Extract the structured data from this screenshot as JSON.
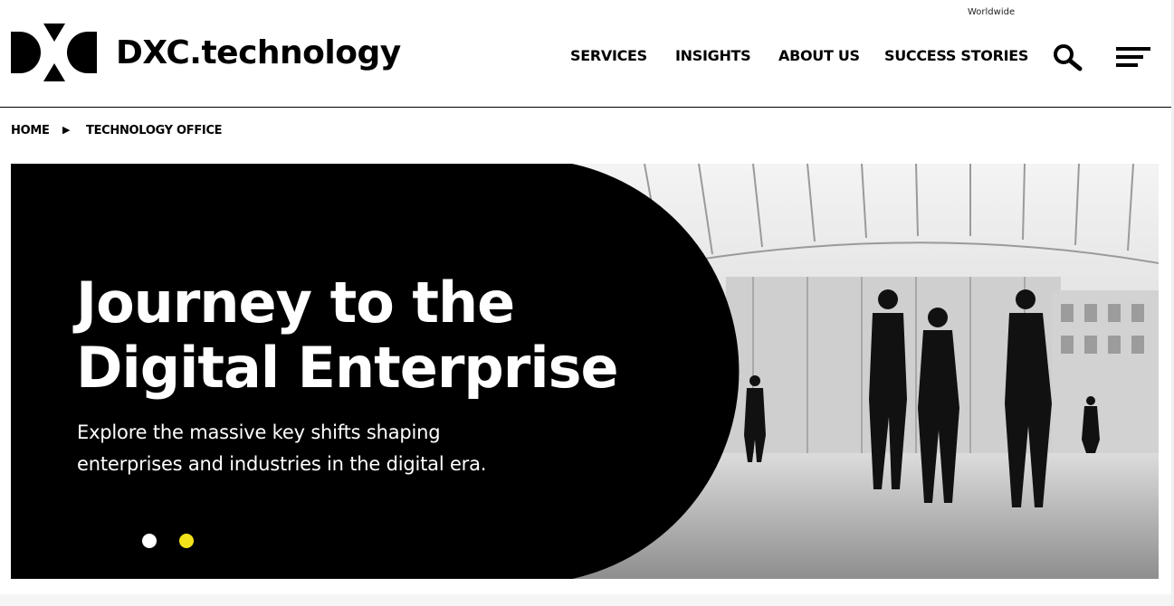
{
  "header": {
    "region_label": "Worldwide",
    "brand_name": "DXC.technology",
    "nav": [
      {
        "label": "SERVICES"
      },
      {
        "label": "INSIGHTS"
      },
      {
        "label": "ABOUT US"
      },
      {
        "label": "SUCCESS STORIES"
      }
    ],
    "icons": {
      "search": "search-icon",
      "menu": "hamburger-menu-icon",
      "logo": "dxc-logo-mark"
    }
  },
  "breadcrumb": {
    "items": [
      {
        "label": "HOME"
      },
      {
        "label": "TECHNOLOGY OFFICE"
      }
    ],
    "separator_icon": "triangle-right-icon",
    "separator_glyph": "▶"
  },
  "hero": {
    "title_line1": "Journey to the",
    "title_line2": "Digital Enterprise",
    "subtitle_line1": "Explore the massive key shifts shaping",
    "subtitle_line2": "enterprises and industries in the digital era.",
    "carousel": {
      "total": 2,
      "active_index": 1
    },
    "colors": {
      "panel": "#000000",
      "dot_inactive": "#ffffff",
      "dot_active": "#f2e21a"
    }
  }
}
